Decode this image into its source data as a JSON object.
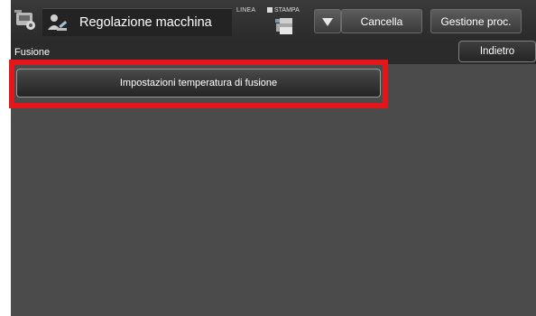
{
  "header": {
    "title": "Regolazione macchina",
    "status_line": "LINEA",
    "status_print": "STAMPA",
    "cancel_label": "Cancella",
    "job_management_label": "Gestione proc."
  },
  "subheader": {
    "title": "Fusione",
    "back_label": "Indietro"
  },
  "main": {
    "items": [
      {
        "label": "Impostazioni temperatura di fusione"
      }
    ]
  },
  "colors": {
    "highlight": "#e3161b",
    "background": "#4b4b4b",
    "header": "#2b2b2b"
  },
  "icons": {
    "app": "machine-adjust-icon",
    "title": "user-wrench-icon",
    "printer": "printer-status-icon",
    "dropdown": "triangle-down-icon"
  }
}
